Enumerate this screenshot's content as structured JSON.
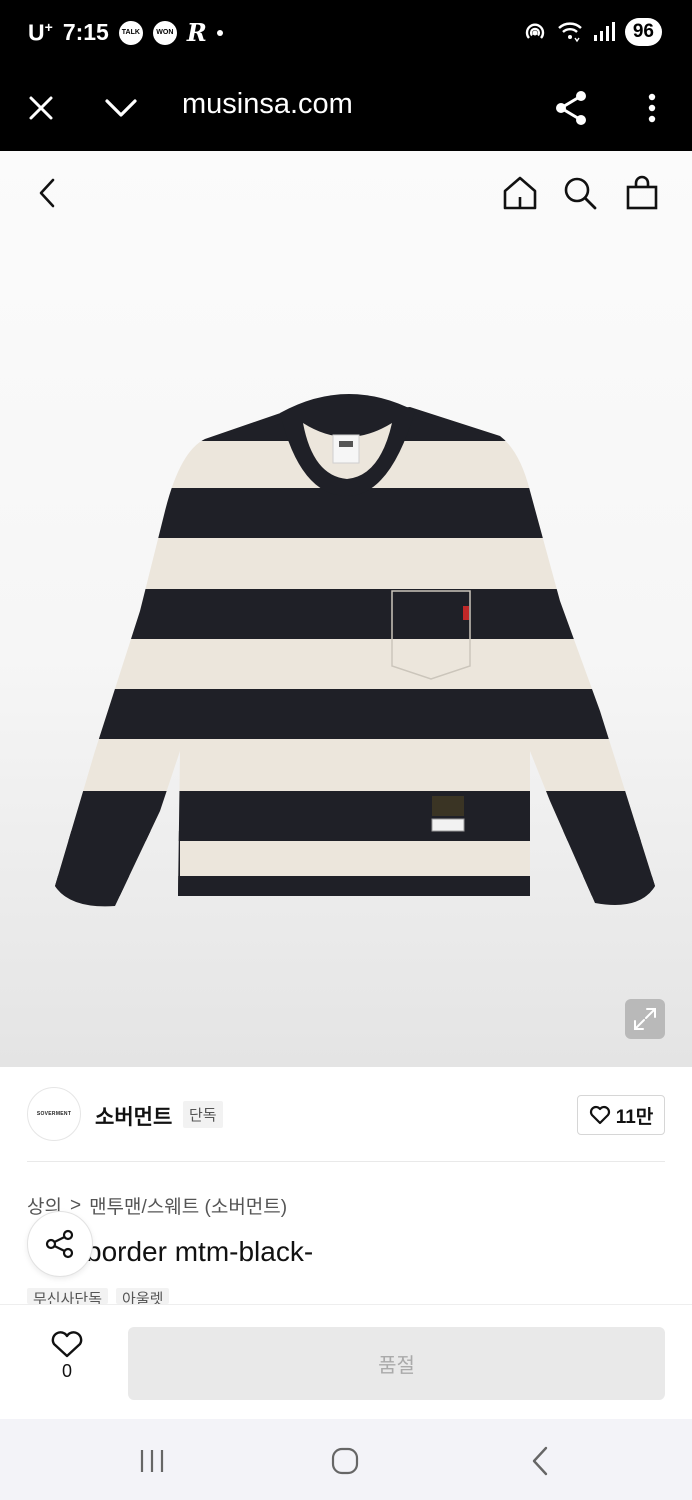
{
  "status_bar": {
    "carrier": "U",
    "carrier_sup": "+",
    "time": "7:15",
    "notif_talk": "TALK",
    "notif_won": "WON",
    "battery": "96"
  },
  "browser": {
    "url": "musinsa.com"
  },
  "brand": {
    "logo_text": "SOVERMENT",
    "name": "소버먼트",
    "badge": "단독",
    "likes": "11만"
  },
  "breadcrumb": {
    "level1": "상의",
    "separator": ">",
    "level2": "맨투맨/스웨트 (소버먼트)"
  },
  "product": {
    "title_visible": "border mtm-black-"
  },
  "tags": [
    "무신사단독",
    "아울렛"
  ],
  "bottom_bar": {
    "wish_count": "0",
    "buy_label": "품절"
  },
  "colors": {
    "shirt_black": "#1f2027",
    "shirt_cream": "#ece6dc",
    "accent": "#000000"
  }
}
